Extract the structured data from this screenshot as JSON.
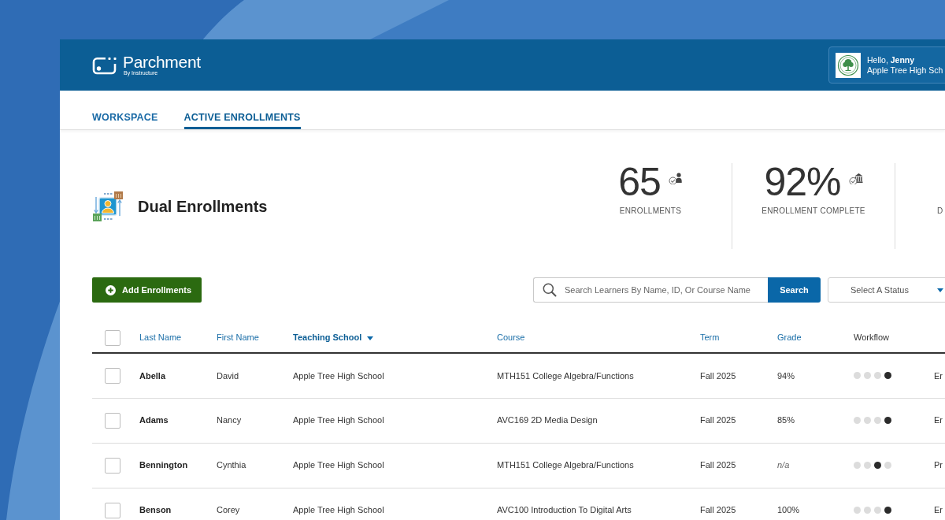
{
  "header": {
    "logo": {
      "name": "Parchment",
      "tagline": "By Instructure"
    },
    "user": {
      "greeting": "Hello, **Jenny**",
      "school": "Apple Tree High Sch"
    }
  },
  "tabs": [
    {
      "label": "WORKSPACE",
      "selected": false
    },
    {
      "label": "ACTIVE ENROLLMENTS",
      "selected": true
    }
  ],
  "page": {
    "title": "Dual Enrollments"
  },
  "stats": [
    {
      "kind": "people",
      "value": "65",
      "label": "ENROLLMENTS"
    },
    {
      "kind": "institution",
      "value": "92%",
      "label": "ENROLLMENT COMPLETE"
    },
    {
      "label": "D"
    }
  ],
  "toolbar": {
    "add_button": "Add Enrollments",
    "search": {
      "placeholder": "Search Learners By Name, ID, Or Course Name",
      "button": "Search"
    },
    "status_select": {
      "placeholder": "Select A Status"
    }
  },
  "table": {
    "select_all": {
      "checked": false
    },
    "columns": [
      {
        "label": "Last Name",
        "sortable": true,
        "sorted": false
      },
      {
        "label": "First Name",
        "sortable": true,
        "sorted": false
      },
      {
        "label": "Teaching School",
        "sortable": true,
        "sorted": true
      },
      {
        "label": "Course",
        "sortable": true,
        "sorted": false
      },
      {
        "label": "Term",
        "sortable": true,
        "sorted": false
      },
      {
        "label": "Grade",
        "sortable": true,
        "sorted": false
      },
      {
        "label": "Workflow",
        "sortable": false,
        "sorted": false
      }
    ],
    "rows": [
      {
        "checked": false,
        "last_name": "Abella",
        "first_name": "David",
        "teaching_school": "Apple Tree High School",
        "course": "MTH151 College Algebra/Functions",
        "term": "Fall 2025",
        "grade": "94%",
        "grade_available": true,
        "workflow": [
          {
            "active": false
          },
          {
            "active": false
          },
          {
            "active": false
          },
          {
            "active": true
          }
        ],
        "column_8": "Er"
      },
      {
        "checked": false,
        "last_name": "Adams",
        "first_name": "Nancy",
        "teaching_school": "Apple Tree High School",
        "course": "AVC169 2D Media Design",
        "term": "Fall 2025",
        "grade": "85%",
        "grade_available": true,
        "workflow": [
          {
            "active": false
          },
          {
            "active": false
          },
          {
            "active": false
          },
          {
            "active": true
          }
        ],
        "column_8": "Er"
      },
      {
        "checked": false,
        "last_name": "Bennington",
        "first_name": "Cynthia",
        "teaching_school": "Apple Tree High School",
        "course": "MTH151 College Algebra/Functions",
        "term": "Fall 2025",
        "grade": "n/a",
        "grade_available": false,
        "workflow": [
          {
            "active": false
          },
          {
            "active": false
          },
          {
            "active": true
          },
          {
            "active": false
          }
        ],
        "column_8": "Pr"
      },
      {
        "checked": false,
        "last_name": "Benson",
        "first_name": "Corey",
        "teaching_school": "Apple Tree High School",
        "course": "AVC100 Introduction To Digital Arts",
        "term": "Fall 2025",
        "grade": "100%",
        "grade_available": true,
        "workflow": [
          {
            "active": false
          },
          {
            "active": false
          },
          {
            "active": false
          },
          {
            "active": true
          }
        ],
        "column_8": "Er"
      }
    ]
  }
}
